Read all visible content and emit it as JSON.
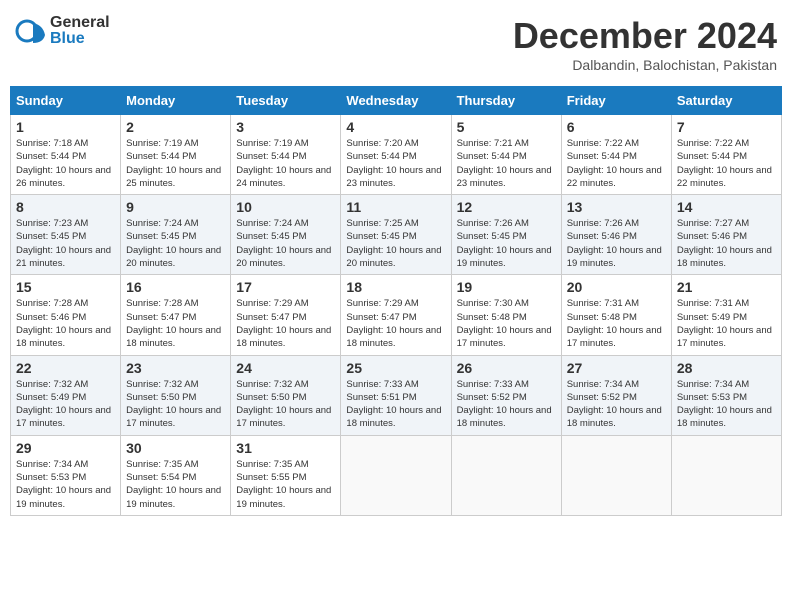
{
  "header": {
    "logo_general": "General",
    "logo_blue": "Blue",
    "month_title": "December 2024",
    "location": "Dalbandin, Balochistan, Pakistan"
  },
  "weekdays": [
    "Sunday",
    "Monday",
    "Tuesday",
    "Wednesday",
    "Thursday",
    "Friday",
    "Saturday"
  ],
  "weeks": [
    [
      {
        "day": "1",
        "sunrise": "Sunrise: 7:18 AM",
        "sunset": "Sunset: 5:44 PM",
        "daylight": "Daylight: 10 hours and 26 minutes."
      },
      {
        "day": "2",
        "sunrise": "Sunrise: 7:19 AM",
        "sunset": "Sunset: 5:44 PM",
        "daylight": "Daylight: 10 hours and 25 minutes."
      },
      {
        "day": "3",
        "sunrise": "Sunrise: 7:19 AM",
        "sunset": "Sunset: 5:44 PM",
        "daylight": "Daylight: 10 hours and 24 minutes."
      },
      {
        "day": "4",
        "sunrise": "Sunrise: 7:20 AM",
        "sunset": "Sunset: 5:44 PM",
        "daylight": "Daylight: 10 hours and 23 minutes."
      },
      {
        "day": "5",
        "sunrise": "Sunrise: 7:21 AM",
        "sunset": "Sunset: 5:44 PM",
        "daylight": "Daylight: 10 hours and 23 minutes."
      },
      {
        "day": "6",
        "sunrise": "Sunrise: 7:22 AM",
        "sunset": "Sunset: 5:44 PM",
        "daylight": "Daylight: 10 hours and 22 minutes."
      },
      {
        "day": "7",
        "sunrise": "Sunrise: 7:22 AM",
        "sunset": "Sunset: 5:44 PM",
        "daylight": "Daylight: 10 hours and 22 minutes."
      }
    ],
    [
      {
        "day": "8",
        "sunrise": "Sunrise: 7:23 AM",
        "sunset": "Sunset: 5:45 PM",
        "daylight": "Daylight: 10 hours and 21 minutes."
      },
      {
        "day": "9",
        "sunrise": "Sunrise: 7:24 AM",
        "sunset": "Sunset: 5:45 PM",
        "daylight": "Daylight: 10 hours and 20 minutes."
      },
      {
        "day": "10",
        "sunrise": "Sunrise: 7:24 AM",
        "sunset": "Sunset: 5:45 PM",
        "daylight": "Daylight: 10 hours and 20 minutes."
      },
      {
        "day": "11",
        "sunrise": "Sunrise: 7:25 AM",
        "sunset": "Sunset: 5:45 PM",
        "daylight": "Daylight: 10 hours and 20 minutes."
      },
      {
        "day": "12",
        "sunrise": "Sunrise: 7:26 AM",
        "sunset": "Sunset: 5:45 PM",
        "daylight": "Daylight: 10 hours and 19 minutes."
      },
      {
        "day": "13",
        "sunrise": "Sunrise: 7:26 AM",
        "sunset": "Sunset: 5:46 PM",
        "daylight": "Daylight: 10 hours and 19 minutes."
      },
      {
        "day": "14",
        "sunrise": "Sunrise: 7:27 AM",
        "sunset": "Sunset: 5:46 PM",
        "daylight": "Daylight: 10 hours and 18 minutes."
      }
    ],
    [
      {
        "day": "15",
        "sunrise": "Sunrise: 7:28 AM",
        "sunset": "Sunset: 5:46 PM",
        "daylight": "Daylight: 10 hours and 18 minutes."
      },
      {
        "day": "16",
        "sunrise": "Sunrise: 7:28 AM",
        "sunset": "Sunset: 5:47 PM",
        "daylight": "Daylight: 10 hours and 18 minutes."
      },
      {
        "day": "17",
        "sunrise": "Sunrise: 7:29 AM",
        "sunset": "Sunset: 5:47 PM",
        "daylight": "Daylight: 10 hours and 18 minutes."
      },
      {
        "day": "18",
        "sunrise": "Sunrise: 7:29 AM",
        "sunset": "Sunset: 5:47 PM",
        "daylight": "Daylight: 10 hours and 18 minutes."
      },
      {
        "day": "19",
        "sunrise": "Sunrise: 7:30 AM",
        "sunset": "Sunset: 5:48 PM",
        "daylight": "Daylight: 10 hours and 17 minutes."
      },
      {
        "day": "20",
        "sunrise": "Sunrise: 7:31 AM",
        "sunset": "Sunset: 5:48 PM",
        "daylight": "Daylight: 10 hours and 17 minutes."
      },
      {
        "day": "21",
        "sunrise": "Sunrise: 7:31 AM",
        "sunset": "Sunset: 5:49 PM",
        "daylight": "Daylight: 10 hours and 17 minutes."
      }
    ],
    [
      {
        "day": "22",
        "sunrise": "Sunrise: 7:32 AM",
        "sunset": "Sunset: 5:49 PM",
        "daylight": "Daylight: 10 hours and 17 minutes."
      },
      {
        "day": "23",
        "sunrise": "Sunrise: 7:32 AM",
        "sunset": "Sunset: 5:50 PM",
        "daylight": "Daylight: 10 hours and 17 minutes."
      },
      {
        "day": "24",
        "sunrise": "Sunrise: 7:32 AM",
        "sunset": "Sunset: 5:50 PM",
        "daylight": "Daylight: 10 hours and 17 minutes."
      },
      {
        "day": "25",
        "sunrise": "Sunrise: 7:33 AM",
        "sunset": "Sunset: 5:51 PM",
        "daylight": "Daylight: 10 hours and 18 minutes."
      },
      {
        "day": "26",
        "sunrise": "Sunrise: 7:33 AM",
        "sunset": "Sunset: 5:52 PM",
        "daylight": "Daylight: 10 hours and 18 minutes."
      },
      {
        "day": "27",
        "sunrise": "Sunrise: 7:34 AM",
        "sunset": "Sunset: 5:52 PM",
        "daylight": "Daylight: 10 hours and 18 minutes."
      },
      {
        "day": "28",
        "sunrise": "Sunrise: 7:34 AM",
        "sunset": "Sunset: 5:53 PM",
        "daylight": "Daylight: 10 hours and 18 minutes."
      }
    ],
    [
      {
        "day": "29",
        "sunrise": "Sunrise: 7:34 AM",
        "sunset": "Sunset: 5:53 PM",
        "daylight": "Daylight: 10 hours and 19 minutes."
      },
      {
        "day": "30",
        "sunrise": "Sunrise: 7:35 AM",
        "sunset": "Sunset: 5:54 PM",
        "daylight": "Daylight: 10 hours and 19 minutes."
      },
      {
        "day": "31",
        "sunrise": "Sunrise: 7:35 AM",
        "sunset": "Sunset: 5:55 PM",
        "daylight": "Daylight: 10 hours and 19 minutes."
      },
      null,
      null,
      null,
      null
    ]
  ]
}
